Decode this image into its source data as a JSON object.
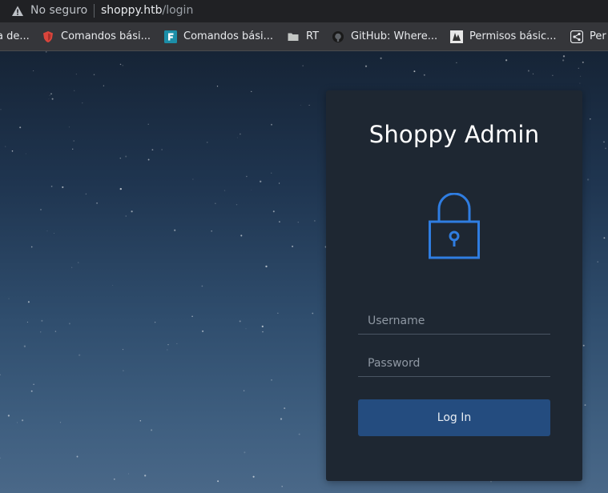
{
  "browser": {
    "security_label": "No seguro",
    "url_host": "shoppy.htb",
    "url_path": "/login",
    "bookmarks": [
      {
        "label": "a de...",
        "icon": "none"
      },
      {
        "label": "Comandos bási...",
        "icon": "shield-icon"
      },
      {
        "label": "Comandos bási...",
        "icon": "f-letter-icon"
      },
      {
        "label": "RT",
        "icon": "folder-icon"
      },
      {
        "label": "GitHub: Where...",
        "icon": "github-icon"
      },
      {
        "label": "Permisos básic...",
        "icon": "permissions-icon"
      },
      {
        "label": "Per",
        "icon": "share-icon"
      }
    ]
  },
  "login": {
    "title": "Shoppy Admin",
    "username_placeholder": "Username",
    "password_placeholder": "Password",
    "submit_label": "Log In"
  },
  "colors": {
    "card_background": "#1e2732",
    "lock_accent": "#2f7de1",
    "button_background": "#244c7f"
  }
}
